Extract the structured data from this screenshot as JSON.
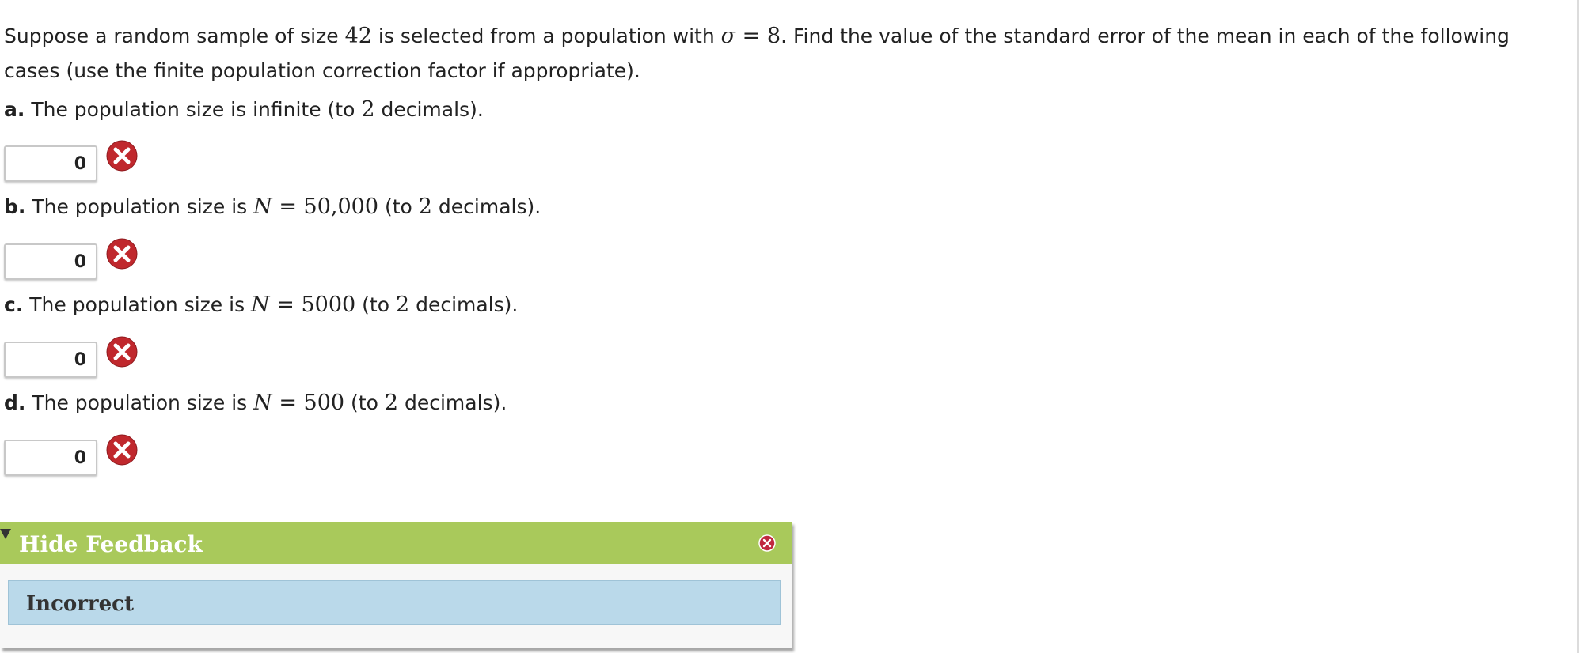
{
  "intro": {
    "p1": "Suppose a random sample of size ",
    "n": "42",
    "p2": " is selected from a population with ",
    "sigma_sym": "σ",
    "eq": " = ",
    "sigma_val": "8",
    "p3": ". Find the value of the standard error of the mean in each of the following cases (use the finite population correction factor if appropriate)."
  },
  "questions": [
    {
      "letter": "a.",
      "text_before": " The population size is infinite (to ",
      "math_N": "",
      "math_eq": "",
      "math_value": "",
      "decimals": "2",
      "text_after": " decimals).",
      "answer": "0",
      "status": "incorrect"
    },
    {
      "letter": "b.",
      "text_before": " The population size is ",
      "math_N": "N",
      "math_eq": " = ",
      "math_value": "50,000",
      "decimals": "2",
      "text_after": " decimals).",
      "mid": " (to ",
      "answer": "0",
      "status": "incorrect"
    },
    {
      "letter": "c.",
      "text_before": " The population size is ",
      "math_N": "N",
      "math_eq": " = ",
      "math_value": "5000",
      "decimals": "2",
      "text_after": " decimals).",
      "mid": " (to ",
      "answer": "0",
      "status": "incorrect"
    },
    {
      "letter": "d.",
      "text_before": " The population size is ",
      "math_N": "N",
      "math_eq": " = ",
      "math_value": "500",
      "decimals": "2",
      "text_after": " decimals).",
      "mid": " (to ",
      "answer": "0",
      "status": "incorrect"
    }
  ],
  "feedback": {
    "title": "Hide Feedback",
    "result": "Incorrect"
  },
  "colors": {
    "feedback_header": "#a9c95b",
    "feedback_result_bg": "#bad9ea",
    "wrong_icon": "#c0282d",
    "close_icon": "#c0283f"
  },
  "icons": {
    "wrong": "x-circle-icon",
    "close": "close-icon",
    "collapse": "triangle-down-icon"
  }
}
